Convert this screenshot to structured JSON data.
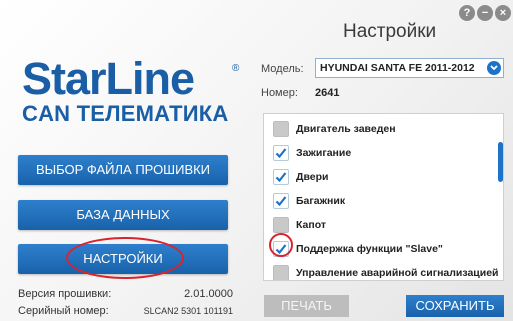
{
  "window": {
    "title": "Настройки",
    "controls": {
      "help": "?",
      "minimize": "−",
      "close": "×"
    }
  },
  "brand": {
    "name": "StarLine",
    "registered": "®",
    "subtitle": "CAN ТЕЛЕМАТИКА"
  },
  "menu": {
    "firmware_button": "ВЫБОР ФАЙЛА ПРОШИВКИ",
    "database_button": "БАЗА ДАННЫХ",
    "settings_button": "НАСТРОЙКИ"
  },
  "info": {
    "firmware_label": "Версия прошивки:",
    "firmware_value": "2.01.0000",
    "serial_label": "Серийный номер:",
    "serial_value": "SLCAN2 5301 101191"
  },
  "settings": {
    "model_label": "Модель:",
    "model_value": "HYUNDAI SANTA FE 2011-2012",
    "number_label": "Номер:",
    "number_value": "2641",
    "options": [
      {
        "label": "Двигатель заведен",
        "checked": false
      },
      {
        "label": "Зажигание",
        "checked": true
      },
      {
        "label": "Двери",
        "checked": true
      },
      {
        "label": "Багажник",
        "checked": true
      },
      {
        "label": "Капот",
        "checked": false
      },
      {
        "label": "Поддержка функции \"Slave\"",
        "checked": true
      },
      {
        "label": "Управление аварийной сигнализацией",
        "checked": false
      }
    ]
  },
  "actions": {
    "print_button": "ПЕЧАТЬ",
    "save_button": "СОХРАНИТЬ"
  },
  "colors": {
    "accent": "#1d73c9",
    "brand": "#1a5ea6",
    "highlight": "#d9232f",
    "disabled": "#bdbdbd"
  }
}
